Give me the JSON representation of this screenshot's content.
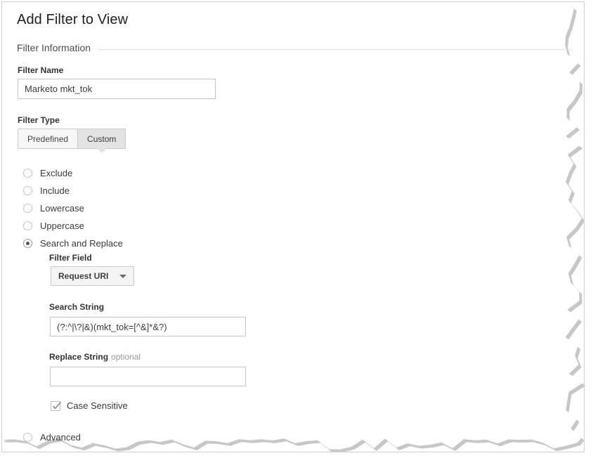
{
  "dialog": {
    "title": "Add Filter to View",
    "section_heading": "Filter Information"
  },
  "filter_name": {
    "label": "Filter Name",
    "value": "Marketo mkt_tok",
    "placeholder": ""
  },
  "filter_type": {
    "label": "Filter Type",
    "options": [
      {
        "label": "Predefined",
        "selected": false
      },
      {
        "label": "Custom",
        "selected": true
      }
    ]
  },
  "custom_options": {
    "items": [
      {
        "label": "Exclude",
        "selected": false
      },
      {
        "label": "Include",
        "selected": false
      },
      {
        "label": "Lowercase",
        "selected": false
      },
      {
        "label": "Uppercase",
        "selected": false
      },
      {
        "label": "Search and Replace",
        "selected": true
      },
      {
        "label": "Advanced",
        "selected": false
      }
    ]
  },
  "search_and_replace": {
    "filter_field": {
      "label": "Filter Field",
      "value": "Request URI"
    },
    "search_string": {
      "label": "Search String",
      "value": "(?:^|\\?|&)(mkt_tok=[^&]*&?)",
      "placeholder": ""
    },
    "replace_string": {
      "label": "Replace String",
      "optional_note": "optional",
      "value": "",
      "placeholder": ""
    },
    "case_sensitive": {
      "label": "Case Sensitive",
      "checked": true
    }
  },
  "icons": {
    "caret": "chevron-down-icon",
    "check": "checkmark-icon"
  },
  "colors": {
    "page_background": "#ffffff",
    "title_text": "#212121",
    "label_text": "#333333",
    "muted_text": "#9b9b9b",
    "input_border": "#c6c6c6",
    "rule": "#e2e2e2",
    "segment_selected_bg": "#e3e3e3",
    "segment_bg": "#f6f6f6"
  }
}
